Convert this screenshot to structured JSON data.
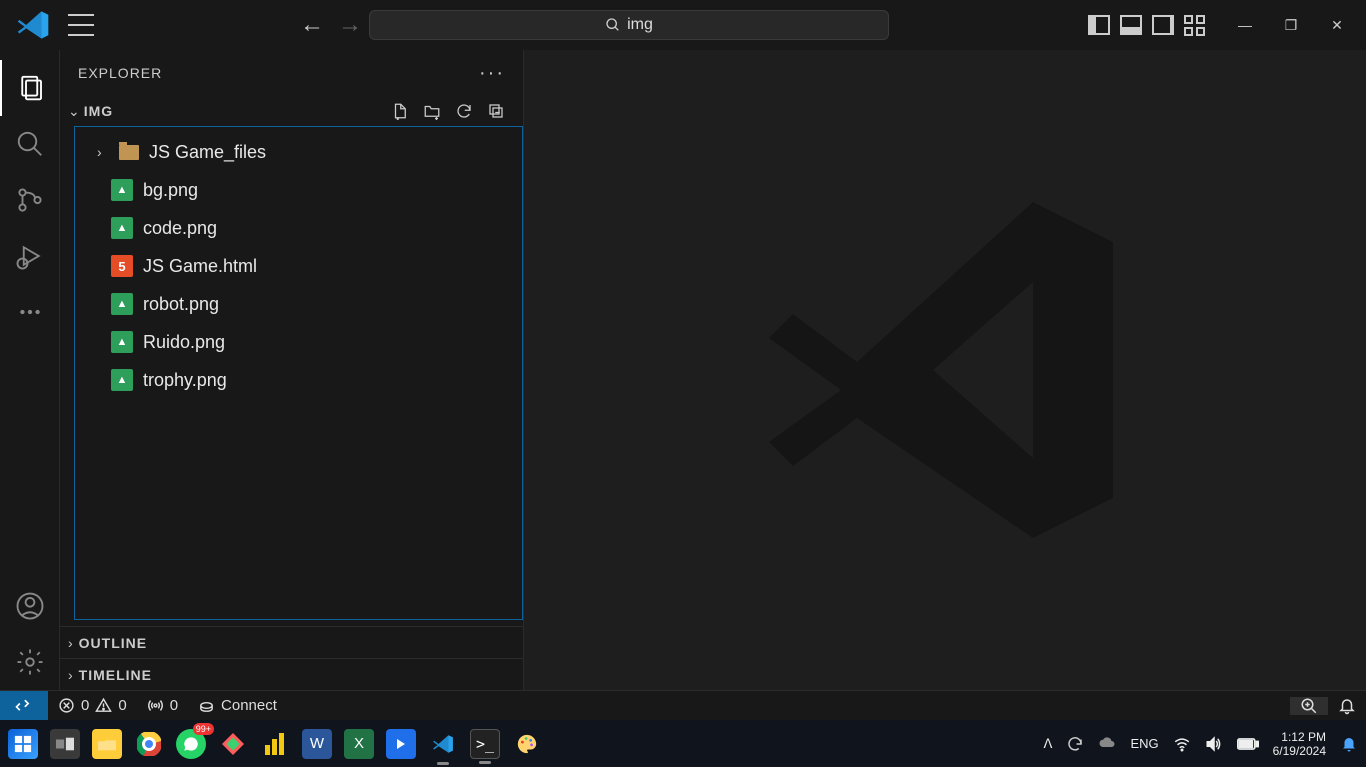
{
  "title_search": {
    "text": "img"
  },
  "explorer": {
    "title": "EXPLORER",
    "folder_section": "IMG",
    "collapsed": [
      "OUTLINE",
      "TIMELINE"
    ],
    "tree": [
      {
        "name": "JS Game_files",
        "kind": "folder",
        "expandable": true
      },
      {
        "name": "bg.png",
        "kind": "image"
      },
      {
        "name": "code.png",
        "kind": "image"
      },
      {
        "name": "JS Game.html",
        "kind": "html"
      },
      {
        "name": "robot.png",
        "kind": "image"
      },
      {
        "name": "Ruido.png",
        "kind": "image"
      },
      {
        "name": "trophy.png",
        "kind": "image"
      }
    ]
  },
  "statusbar": {
    "errors": "0",
    "warnings": "0",
    "ports": "0",
    "connect": "Connect"
  },
  "tray": {
    "lang": "ENG",
    "time": "1:12 PM",
    "date": "6/19/2024",
    "whatsapp_badge": "99+"
  }
}
